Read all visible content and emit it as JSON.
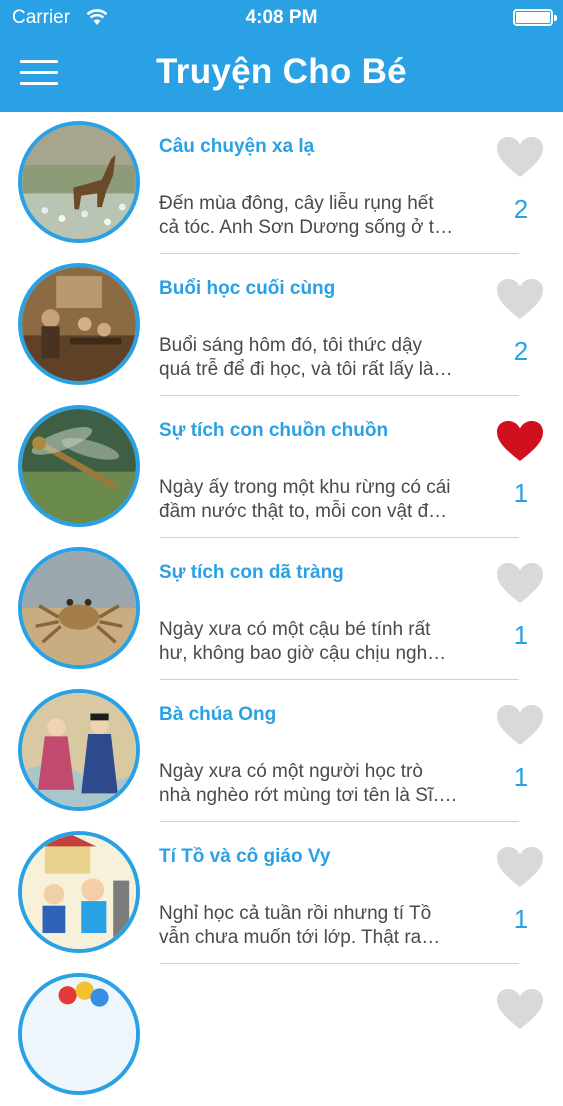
{
  "status_bar": {
    "carrier": "Carrier",
    "time": "4:08 PM"
  },
  "header": {
    "title": "Truyện Cho Bé"
  },
  "colors": {
    "accent": "#2aa1e4",
    "heart_liked": "#d0101e",
    "heart_unliked": "#d9d9d9"
  },
  "stories": [
    {
      "title": "Câu chuyện xa lạ",
      "desc_line1": "Đến mùa đông, cây liễu rụng hết",
      "desc_line2": "cả tóc. Anh Sơn Dương sống ở t…",
      "count": "2",
      "liked": false
    },
    {
      "title": "Buổi học cuối cùng",
      "desc_line1": "Buổi sáng hôm đó, tôi thức dậy",
      "desc_line2": "quá trễ để đi học, và tôi rất lấy là…",
      "count": "2",
      "liked": false
    },
    {
      "title": "Sự tích con chuồn chuồn",
      "desc_line1": "Ngày ấy trong một khu rừng có cái",
      "desc_line2": "đầm nước thật to, mỗi con vật đ…",
      "count": "1",
      "liked": true
    },
    {
      "title": "Sự tích con dã tràng",
      "desc_line1": "Ngày xưa có một cậu bé tính rất",
      "desc_line2": "hư, không bao giờ cậu chịu ngh…",
      "count": "1",
      "liked": false
    },
    {
      "title": "Bà chúa Ong",
      "desc_line1": "Ngày xưa có một người học trò",
      "desc_line2": "nhà nghèo rớt mùng tơi tên là Sĩ.…",
      "count": "1",
      "liked": false
    },
    {
      "title": "Tí Tồ và cô giáo Vy",
      "desc_line1": "Nghỉ học cả tuần rồi  nhưng tí Tồ",
      "desc_line2": "vẫn chưa muốn tới lớp. Thật ra…",
      "count": "1",
      "liked": false
    }
  ],
  "icons": {
    "menu": "hamburger-menu-icon",
    "heart": "heart-icon",
    "wifi": "wifi-icon",
    "battery": "battery-icon"
  }
}
